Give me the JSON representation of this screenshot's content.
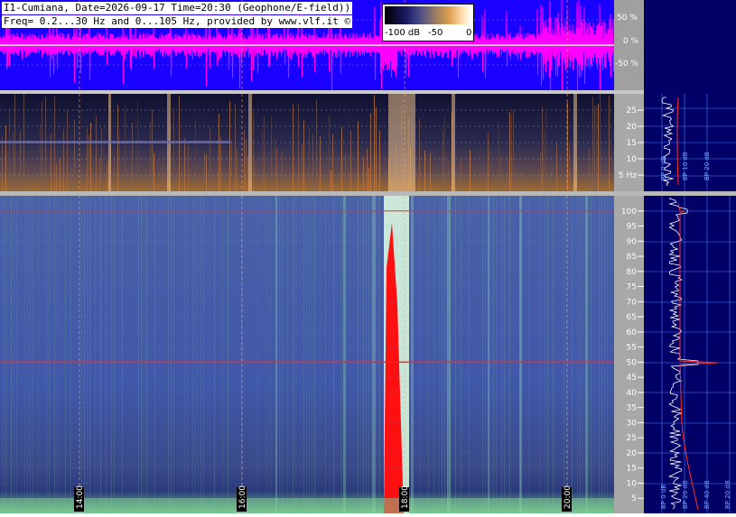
{
  "header": {
    "line1": "I1-Cumiana, Date=2026-09-17 Time=20:30 (Geophone/E-field))",
    "line2": "Freq= 0.2...30 Hz and 0...105 Hz, provided by www.vlf.it ©"
  },
  "colorbar": {
    "min_label": "-100 dB",
    "mid_label": "-50",
    "max_label": "0"
  },
  "waveform_axis": {
    "ticks": [
      "50 %",
      "0 %",
      "-50 %"
    ]
  },
  "colors": {
    "waveform": "#ff00ff",
    "waveform_bg": "#1a00ff",
    "spectrum_line": "#ff2020",
    "right_panel": "#000066"
  },
  "chart_data": [
    {
      "type": "heatmap",
      "name_printed": "",
      "y_unit": "Hz",
      "y_ticks": [
        "25",
        "20",
        "15",
        "10",
        "5 Hz"
      ],
      "y_values": [
        25,
        20,
        15,
        10,
        5
      ],
      "ylim": [
        0.2,
        30
      ],
      "time_ticks": [
        "14:00",
        "16:00",
        "18:00",
        "20:00"
      ]
    },
    {
      "type": "heatmap",
      "y_ticks": [
        "100",
        "95",
        "90",
        "85",
        "80",
        "75",
        "70",
        "65",
        "60",
        "55",
        "50",
        "45",
        "40",
        "35",
        "30",
        "25",
        "20",
        "15",
        "10",
        "5"
      ],
      "y_values": [
        100,
        95,
        90,
        85,
        80,
        75,
        70,
        65,
        60,
        55,
        50,
        45,
        40,
        35,
        30,
        25,
        20,
        15,
        10,
        5
      ],
      "ylim": [
        0,
        105
      ],
      "time_ticks": [
        "14:00",
        "16:00",
        "18:00",
        "20:00"
      ]
    },
    {
      "type": "line",
      "x_ticks": [
        "BP 0 dB",
        "BP 10 dB",
        "BP 20 dB"
      ],
      "panel": "upper-spectrum"
    },
    {
      "type": "line",
      "x_ticks": [
        "BP 0 dB",
        "BP 20 dB",
        "BP 40 dB",
        "BP 20 dB"
      ],
      "panel": "lower-spectrum"
    }
  ]
}
